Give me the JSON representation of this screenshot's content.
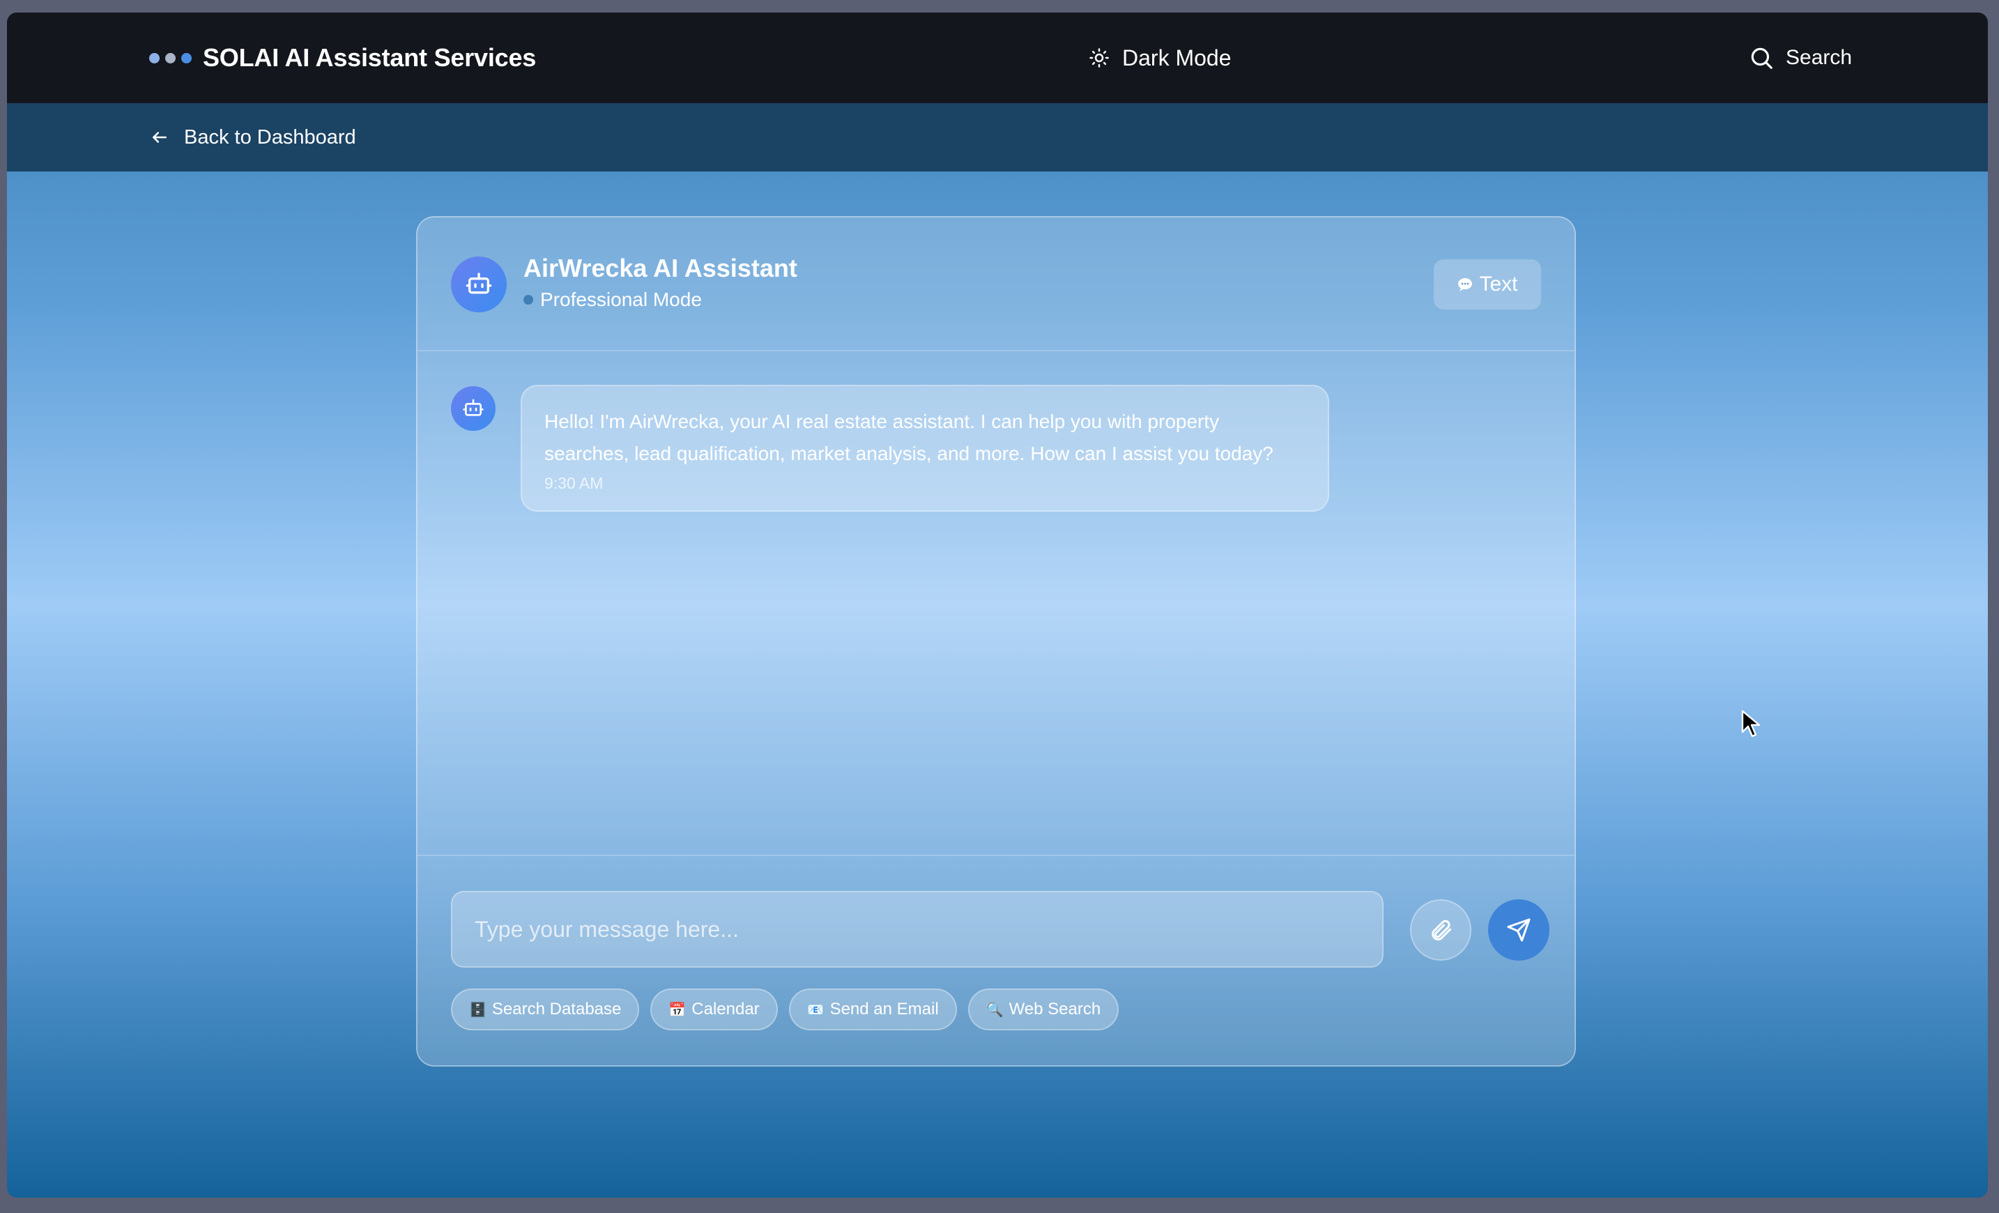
{
  "header": {
    "brand_title": "SOLAI AI Assistant Services",
    "brand_dot_colors": [
      "#8fb0e6",
      "#a9b4c8",
      "#4b8fe4"
    ],
    "dark_mode_label": "Dark Mode",
    "dark_mode_icon": "sun-icon",
    "search_label": "Search",
    "search_icon": "search-icon"
  },
  "nav": {
    "back_label": "Back to Dashboard",
    "back_icon": "arrow-left-icon"
  },
  "chat": {
    "assistant_name": "AirWrecka AI Assistant",
    "mode_label": "Professional Mode",
    "avatar_icon": "robot-icon",
    "toggle_label": "Text",
    "toggle_icon": "chat-bubble-icon",
    "messages": [
      {
        "sender": "assistant",
        "text": "Hello! I'm AirWrecka, your AI real estate assistant. I can help you with property searches, lead qualification, market analysis, and more. How can I assist you today?",
        "time": "9:30 AM"
      }
    ]
  },
  "composer": {
    "placeholder": "Type your message here...",
    "attach_icon": "paperclip-icon",
    "send_icon": "send-icon",
    "accent_color": "#3d83d8",
    "quick_actions": [
      {
        "icon": "🗄️",
        "label": "Search Database"
      },
      {
        "icon": "📅",
        "label": "Calendar"
      },
      {
        "icon": "📧",
        "label": "Send an Email"
      },
      {
        "icon": "🔍",
        "label": "Web Search"
      }
    ]
  }
}
